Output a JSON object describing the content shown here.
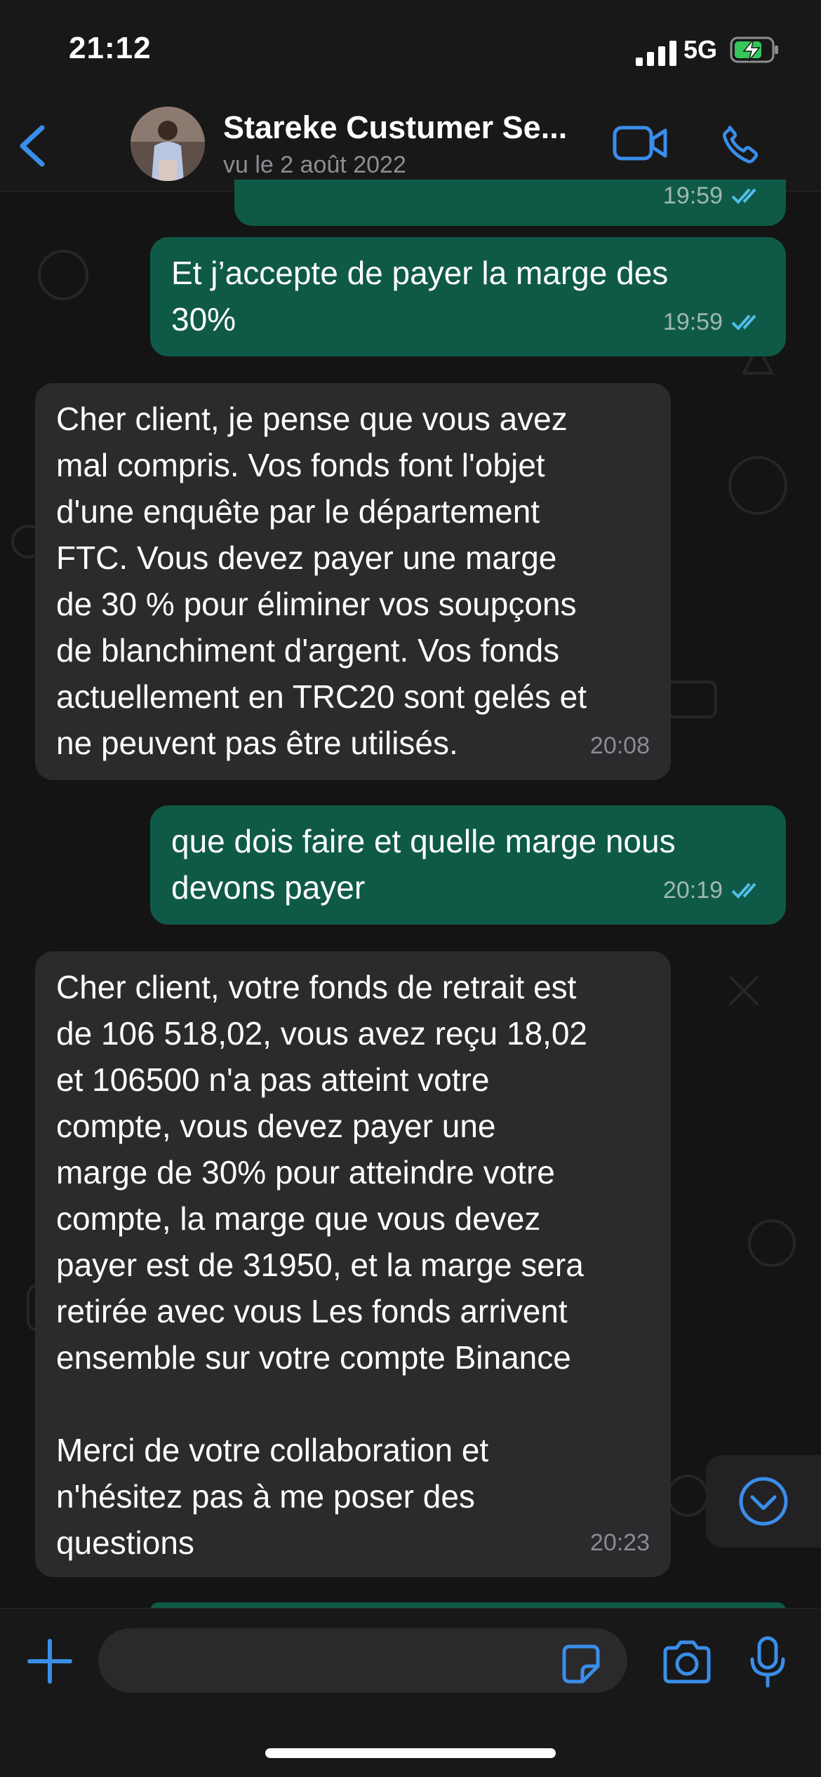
{
  "status_bar": {
    "time": "21:12",
    "network": "5G"
  },
  "header": {
    "contact_name": "Stareke Custumer Se...",
    "last_seen": "vu le 2 août 2022"
  },
  "messages": [
    {
      "direction": "out",
      "text": "",
      "time": "19:59"
    },
    {
      "direction": "out",
      "text": "Et j’accepte de payer la marge des\n30%",
      "time": "19:59"
    },
    {
      "direction": "in",
      "text": "Cher client, je pense que vous avez\nmal compris. Vos fonds font l'objet\nd'une enquête par le département\nFTC. Vous devez payer une marge\nde 30 % pour éliminer vos soupçons\nde blanchiment d'argent. Vos fonds\nactuellement en TRC20 sont gelés et\nne peuvent pas être utilisés.",
      "time": "20:08"
    },
    {
      "direction": "out",
      "text": "que dois faire et quelle marge nous\ndevons payer",
      "time": "20:19"
    },
    {
      "direction": "in",
      "text": "Cher client, votre fonds de retrait est\nde 106 518,02, vous avez reçu 18,02\net 106500 n'a pas atteint votre\ncompte, vous devez payer une\nmarge de 30% pour atteindre votre\ncompte, la marge que vous devez\npayer est de 31950, et la marge sera\nretirée avec vous Les fonds arrivent\nensemble sur votre compte Binance\n\nMerci de votre collaboration et\nn'hésitez pas à me poser des\nquestions",
      "time": "20:23"
    }
  ],
  "colors": {
    "accent": "#3a8eea",
    "outgoing_bubble": "#0f5a47",
    "incoming_bubble": "#2b2b2e",
    "read_ticks": "#53bdeb"
  },
  "icons": {
    "back": "chevron-left-icon",
    "video": "video-camera-icon",
    "phone": "phone-icon",
    "scroll_down": "chevron-down-circle-icon",
    "attach": "plus-icon",
    "sticker": "sticker-icon",
    "camera": "camera-icon",
    "mic": "microphone-icon"
  }
}
